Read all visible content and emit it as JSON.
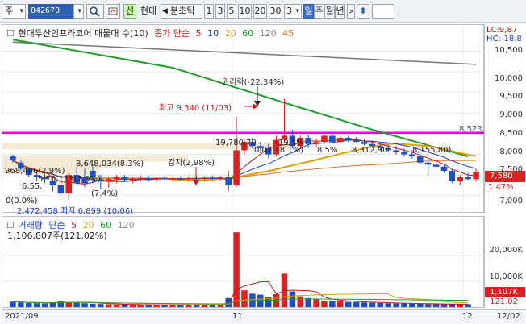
{
  "toolbar": {
    "market_label": "주",
    "code_value": "042670",
    "signal_label": "신",
    "name_label": "현대",
    "period_label": "분초틱",
    "interval_buttons": [
      "1",
      "3",
      "5",
      "10",
      "20",
      "30"
    ],
    "count_value": "3",
    "day_label": "일",
    "week_label": "주",
    "month_label": "월",
    "year_label": "년",
    "updown_icon": "updown-arrow-icon",
    "search_icon": "magnifier-icon"
  },
  "price_panel": {
    "title": "현대두산인프라코어 매물대 수(10)",
    "ma_label": "종가 단순",
    "ma_periods": [
      "5",
      "10",
      "20",
      "60",
      "120",
      "45"
    ],
    "ma_colors": [
      "#d01414",
      "#1c3ed0",
      "#e0a000",
      "#1e9e2a",
      "#888888",
      "#e07020"
    ],
    "lc_label": "LC:9,87",
    "hc_label": "HC:-18.8",
    "ticks": [
      "10,500",
      "10,000",
      "9,500",
      "9,000",
      "8,500",
      "8,000",
      "7,500",
      "7,000"
    ],
    "current_price": "7,580",
    "current_pct": "1.47%",
    "hline_value": "8,523",
    "annotations": {
      "rights": "권리락(-22.34%)",
      "high": "최고 9,340 (11/03)",
      "reduction": "감자(2,98%)",
      "p1": "19,780,70",
      "p2": "19.1%",
      "p3": "8.5%",
      "p4": "8,312,90",
      "p5": "8,155,80)",
      "p6": "8,648,034(8.3%)",
      "p7": "968,406(2.9%)",
      "p8": "5,70,113(7.0%)",
      "p9": "6,55,",
      "p10": "(7.4%)",
      "p11": "0(0.0%)",
      "low": "2,472,458 최저 6,899 (10/06)",
      "p12": "0,07.18.1%)"
    }
  },
  "volume_panel": {
    "title": "거래량",
    "ma_label": "단순",
    "ma_periods": [
      "5",
      "20",
      "60",
      "120"
    ],
    "value_label": "1,106,807주(121.02%)",
    "ticks": [
      "20,000K",
      "10,000K"
    ],
    "current_volume": "1,107K",
    "current_pct": "121.02"
  },
  "x_axis": {
    "labels": [
      "2021/09",
      "11",
      "12",
      "12/02"
    ]
  },
  "colors": {
    "up": "#e02020",
    "down": "#1c4fc8",
    "magenta_line": "#e000e0",
    "ma120": "#777777",
    "ma60": "#1e9e2a"
  },
  "chart_data": {
    "type": "candlestick",
    "ylim": [
      6800,
      10900
    ],
    "candles": [
      {
        "o": 7950,
        "h": 8000,
        "l": 7800,
        "c": 7850
      },
      {
        "o": 7800,
        "h": 7850,
        "l": 7600,
        "c": 7650
      },
      {
        "o": 7650,
        "h": 7700,
        "l": 7450,
        "c": 7500
      },
      {
        "o": 7500,
        "h": 7600,
        "l": 7350,
        "c": 7450
      },
      {
        "o": 7450,
        "h": 7550,
        "l": 7300,
        "c": 7400
      },
      {
        "o": 7350,
        "h": 7450,
        "l": 7100,
        "c": 7250
      },
      {
        "o": 7250,
        "h": 7350,
        "l": 6950,
        "c": 7050
      },
      {
        "o": 7050,
        "h": 7550,
        "l": 6899,
        "c": 7500
      },
      {
        "o": 7500,
        "h": 7700,
        "l": 7250,
        "c": 7300
      },
      {
        "o": 7450,
        "h": 7650,
        "l": 7200,
        "c": 7300
      },
      {
        "o": 7600,
        "h": 7750,
        "l": 7300,
        "c": 7450
      },
      {
        "o": 7400,
        "h": 7500,
        "l": 7150,
        "c": 7350
      },
      {
        "o": 7350,
        "h": 7450,
        "l": 7200,
        "c": 7400
      },
      {
        "o": 7400,
        "h": 7500,
        "l": 7300,
        "c": 7450
      },
      {
        "o": 7450,
        "h": 7500,
        "l": 7350,
        "c": 7380
      },
      {
        "o": 7380,
        "h": 7450,
        "l": 7300,
        "c": 7400
      },
      {
        "o": 7400,
        "h": 7480,
        "l": 7350,
        "c": 7420
      },
      {
        "o": 7420,
        "h": 7480,
        "l": 7350,
        "c": 7400
      },
      {
        "o": 7400,
        "h": 7450,
        "l": 7330,
        "c": 7430
      },
      {
        "o": 7430,
        "h": 7470,
        "l": 7380,
        "c": 7400
      },
      {
        "o": 7400,
        "h": 7450,
        "l": 7350,
        "c": 7420
      },
      {
        "o": 7420,
        "h": 7470,
        "l": 7370,
        "c": 7400
      },
      {
        "o": 7400,
        "h": 7460,
        "l": 7350,
        "c": 7430
      },
      {
        "o": 7430,
        "h": 7480,
        "l": 7380,
        "c": 7410
      },
      {
        "o": 7410,
        "h": 7470,
        "l": 7360,
        "c": 7440
      },
      {
        "o": 7440,
        "h": 7490,
        "l": 7390,
        "c": 7420
      },
      {
        "o": 7420,
        "h": 7480,
        "l": 7370,
        "c": 7450
      },
      {
        "o": 7450,
        "h": 7600,
        "l": 7100,
        "c": 7250
      },
      {
        "o": 7250,
        "h": 8900,
        "l": 7200,
        "c": 8100
      },
      {
        "o": 8100,
        "h": 8350,
        "l": 8000,
        "c": 8300
      },
      {
        "o": 8300,
        "h": 8400,
        "l": 8150,
        "c": 8200
      },
      {
        "o": 8200,
        "h": 8300,
        "l": 8100,
        "c": 8150
      },
      {
        "o": 8150,
        "h": 8250,
        "l": 7900,
        "c": 8000
      },
      {
        "o": 8000,
        "h": 8450,
        "l": 7950,
        "c": 8350
      },
      {
        "o": 8350,
        "h": 9340,
        "l": 8300,
        "c": 8450
      },
      {
        "o": 8450,
        "h": 8600,
        "l": 8150,
        "c": 8200
      },
      {
        "o": 8200,
        "h": 8450,
        "l": 8150,
        "c": 8400
      },
      {
        "o": 8400,
        "h": 8480,
        "l": 8150,
        "c": 8250
      },
      {
        "o": 8250,
        "h": 8380,
        "l": 8200,
        "c": 8300
      },
      {
        "o": 8300,
        "h": 8500,
        "l": 8250,
        "c": 8450
      },
      {
        "o": 8450,
        "h": 8500,
        "l": 8250,
        "c": 8300
      },
      {
        "o": 8300,
        "h": 8450,
        "l": 8250,
        "c": 8400
      },
      {
        "o": 8400,
        "h": 8450,
        "l": 8300,
        "c": 8350
      },
      {
        "o": 8350,
        "h": 8420,
        "l": 8280,
        "c": 8300
      },
      {
        "o": 8300,
        "h": 8380,
        "l": 8220,
        "c": 8250
      },
      {
        "o": 8250,
        "h": 8330,
        "l": 8150,
        "c": 8200
      },
      {
        "o": 8200,
        "h": 8280,
        "l": 8100,
        "c": 8150
      },
      {
        "o": 8150,
        "h": 8250,
        "l": 8050,
        "c": 8100
      },
      {
        "o": 8100,
        "h": 8200,
        "l": 8000,
        "c": 8050
      },
      {
        "o": 8050,
        "h": 8150,
        "l": 7950,
        "c": 8000
      },
      {
        "o": 8000,
        "h": 8100,
        "l": 7900,
        "c": 7950
      },
      {
        "o": 7950,
        "h": 8050,
        "l": 7750,
        "c": 7800
      },
      {
        "o": 7800,
        "h": 7900,
        "l": 7500,
        "c": 7750
      },
      {
        "o": 7750,
        "h": 7800,
        "l": 7650,
        "c": 7700
      },
      {
        "o": 7700,
        "h": 7750,
        "l": 7550,
        "c": 7600
      },
      {
        "o": 7600,
        "h": 7650,
        "l": 7300,
        "c": 7350
      },
      {
        "o": 7350,
        "h": 7500,
        "l": 7250,
        "c": 7450
      },
      {
        "o": 7450,
        "h": 7550,
        "l": 7380,
        "c": 7400
      },
      {
        "o": 7400,
        "h": 7650,
        "l": 7350,
        "c": 7580
      }
    ],
    "volumes": [
      2.1,
      1.8,
      1.6,
      1.5,
      1.4,
      1.9,
      2.4,
      2.0,
      1.7,
      1.5,
      1.3,
      1.2,
      1.1,
      1.0,
      0.9,
      1.0,
      0.9,
      0.8,
      0.9,
      0.8,
      0.9,
      0.8,
      0.9,
      0.8,
      0.9,
      0.8,
      0.9,
      3.5,
      29.0,
      6.5,
      5.2,
      4.8,
      3.9,
      5.0,
      13.0,
      6.1,
      4.2,
      3.5,
      3.0,
      2.5,
      2.3,
      2.2,
      2.0,
      1.9,
      1.8,
      1.7,
      1.6,
      1.5,
      1.4,
      1.4,
      1.3,
      1.3,
      1.2,
      1.2,
      1.1,
      1.1,
      1.1,
      1.1
    ],
    "volume_ylim": [
      0,
      30
    ],
    "ma120": [
      10720,
      10180
    ],
    "ma60_points": [
      [
        0,
        10780
      ],
      [
        20,
        10100
      ],
      [
        34,
        9250
      ],
      [
        45,
        8600
      ],
      [
        57,
        7950
      ]
    ]
  }
}
